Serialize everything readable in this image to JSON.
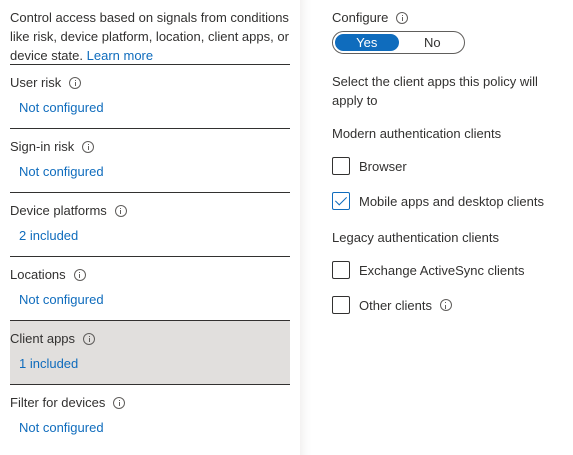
{
  "left": {
    "description": "Control access based on signals from conditions like risk, device platform, location, client apps, or device state.",
    "learn_more": "Learn more",
    "conditions": [
      {
        "title": "User risk",
        "value": "Not configured"
      },
      {
        "title": "Sign-in risk",
        "value": "Not configured"
      },
      {
        "title": "Device platforms",
        "value": "2 included"
      },
      {
        "title": "Locations",
        "value": "Not configured"
      },
      {
        "title": "Client apps",
        "value": "1 included",
        "selected": true
      },
      {
        "title": "Filter for devices",
        "value": "Not configured"
      }
    ]
  },
  "right": {
    "configure_label": "Configure",
    "toggle": {
      "yes": "Yes",
      "no": "No",
      "selected": "Yes"
    },
    "select_text": "Select the client apps this policy will apply to",
    "modern_label": "Modern authentication clients",
    "legacy_label": "Legacy authentication clients",
    "checkboxes": [
      {
        "label": "Browser",
        "checked": false
      },
      {
        "label": "Mobile apps and desktop clients",
        "checked": true
      },
      {
        "label": "Exchange ActiveSync clients",
        "checked": false
      },
      {
        "label": "Other clients",
        "checked": false
      }
    ]
  },
  "colors": {
    "accent": "#0f6cbd",
    "selected_row": "#e1dfdd",
    "text": "#323130"
  }
}
